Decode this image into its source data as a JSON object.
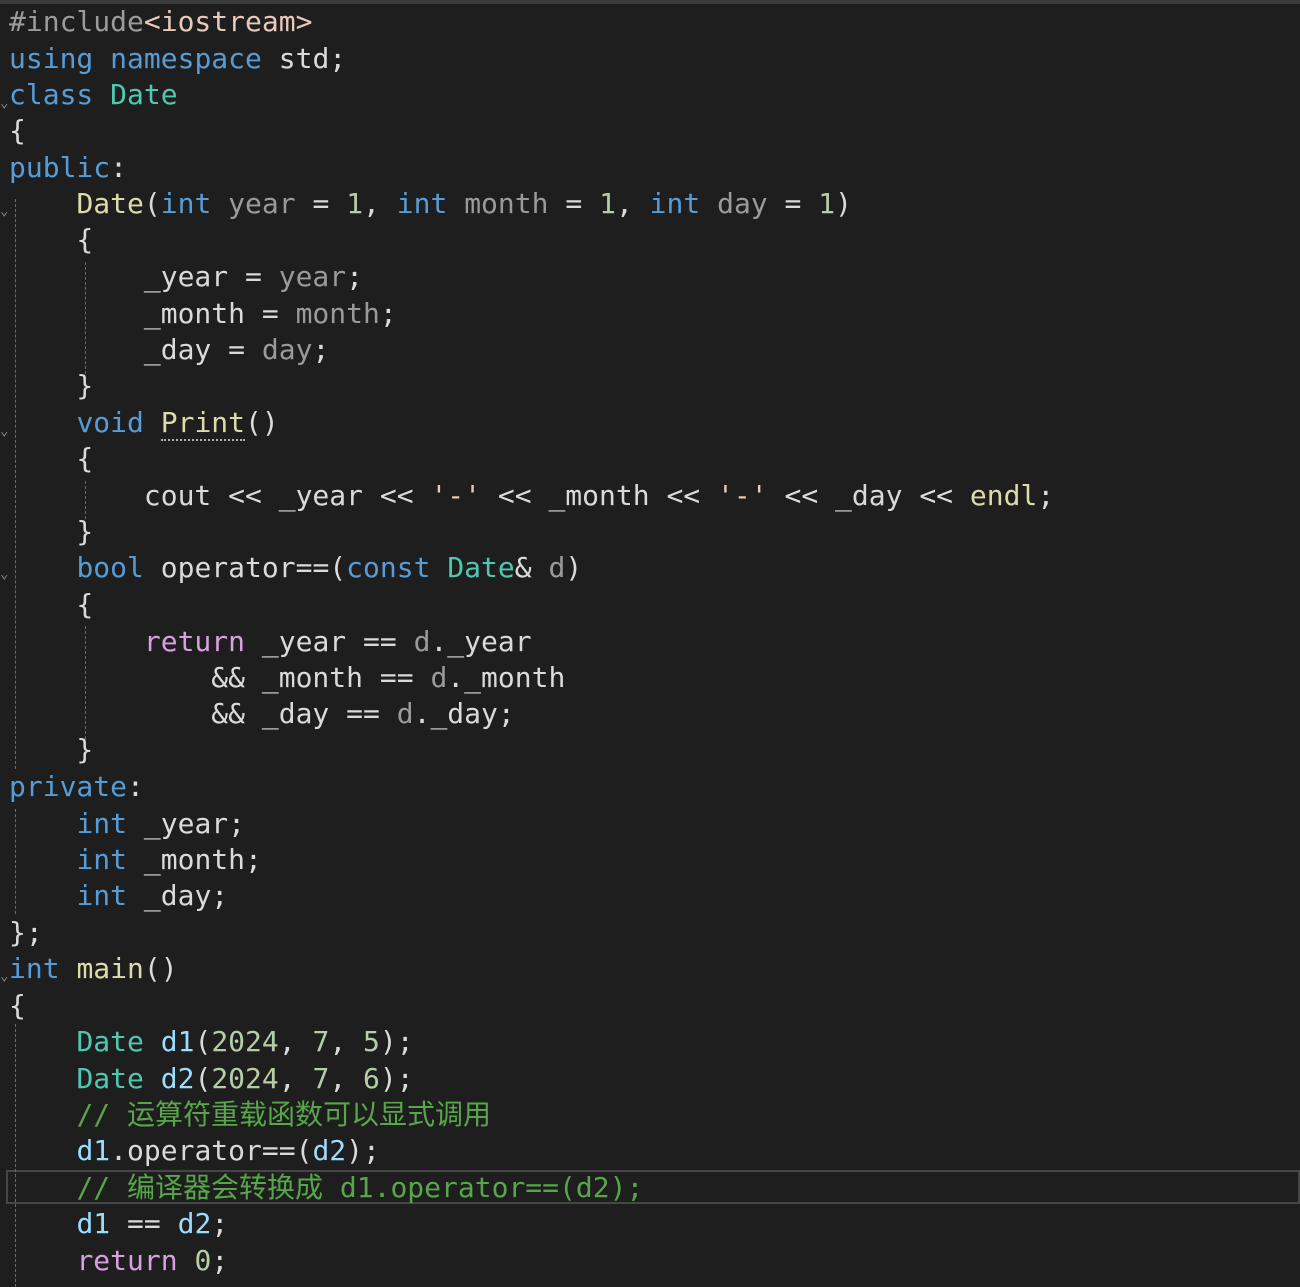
{
  "editor": {
    "background": "#1e1e1e",
    "lines": [
      [
        [
          "pp",
          "#include"
        ],
        [
          "inc",
          "<iostream>"
        ]
      ],
      [
        [
          "kw",
          "using"
        ],
        [
          "plain",
          " "
        ],
        [
          "kw",
          "namespace"
        ],
        [
          "plain",
          " std;"
        ]
      ],
      [
        [
          "kw",
          "class"
        ],
        [
          "plain",
          " "
        ],
        [
          "typ",
          "Date"
        ]
      ],
      [
        [
          "plain",
          "{"
        ]
      ],
      [
        [
          "kw",
          "public"
        ],
        [
          "plain",
          ":"
        ]
      ],
      [
        [
          "plain",
          "    "
        ],
        [
          "fn",
          "Date"
        ],
        [
          "plain",
          "("
        ],
        [
          "kw",
          "int"
        ],
        [
          "plain",
          " "
        ],
        [
          "prm",
          "year"
        ],
        [
          "plain",
          " = "
        ],
        [
          "num",
          "1"
        ],
        [
          "plain",
          ", "
        ],
        [
          "kw",
          "int"
        ],
        [
          "plain",
          " "
        ],
        [
          "prm",
          "month"
        ],
        [
          "plain",
          " = "
        ],
        [
          "num",
          "1"
        ],
        [
          "plain",
          ", "
        ],
        [
          "kw",
          "int"
        ],
        [
          "plain",
          " "
        ],
        [
          "prm",
          "day"
        ],
        [
          "plain",
          " = "
        ],
        [
          "num",
          "1"
        ],
        [
          "plain",
          ")"
        ]
      ],
      [
        [
          "plain",
          "    {"
        ]
      ],
      [
        [
          "plain",
          "        _year = "
        ],
        [
          "prm",
          "year"
        ],
        [
          "plain",
          ";"
        ]
      ],
      [
        [
          "plain",
          "        _month = "
        ],
        [
          "prm",
          "month"
        ],
        [
          "plain",
          ";"
        ]
      ],
      [
        [
          "plain",
          "        _day = "
        ],
        [
          "prm",
          "day"
        ],
        [
          "plain",
          ";"
        ]
      ],
      [
        [
          "plain",
          "    }"
        ]
      ],
      [
        [
          "plain",
          "    "
        ],
        [
          "kw",
          "void"
        ],
        [
          "plain",
          " "
        ],
        [
          "fnu",
          "Print"
        ],
        [
          "plain",
          "()"
        ]
      ],
      [
        [
          "plain",
          "    {"
        ]
      ],
      [
        [
          "plain",
          "        cout << _year << "
        ],
        [
          "str",
          "'-'"
        ],
        [
          "plain",
          " << _month << "
        ],
        [
          "str",
          "'-'"
        ],
        [
          "plain",
          " << _day << "
        ],
        [
          "fn",
          "endl"
        ],
        [
          "plain",
          ";"
        ]
      ],
      [
        [
          "plain",
          "    }"
        ]
      ],
      [
        [
          "plain",
          "    "
        ],
        [
          "kw",
          "bool"
        ],
        [
          "plain",
          " operator==("
        ],
        [
          "kw",
          "const"
        ],
        [
          "plain",
          " "
        ],
        [
          "typ",
          "Date"
        ],
        [
          "plain",
          "& "
        ],
        [
          "prm",
          "d"
        ],
        [
          "plain",
          ")"
        ]
      ],
      [
        [
          "plain",
          "    {"
        ]
      ],
      [
        [
          "plain",
          "        "
        ],
        [
          "ctl",
          "return"
        ],
        [
          "plain",
          " _year == "
        ],
        [
          "prm",
          "d"
        ],
        [
          "plain",
          "._year"
        ]
      ],
      [
        [
          "plain",
          "            && _month == "
        ],
        [
          "prm",
          "d"
        ],
        [
          "plain",
          "._month"
        ]
      ],
      [
        [
          "plain",
          "            && _day == "
        ],
        [
          "prm",
          "d"
        ],
        [
          "plain",
          "._day;"
        ]
      ],
      [
        [
          "plain",
          "    }"
        ]
      ],
      [
        [
          "kw",
          "private"
        ],
        [
          "plain",
          ":"
        ]
      ],
      [
        [
          "plain",
          "    "
        ],
        [
          "kw",
          "int"
        ],
        [
          "plain",
          " _year;"
        ]
      ],
      [
        [
          "plain",
          "    "
        ],
        [
          "kw",
          "int"
        ],
        [
          "plain",
          " _month;"
        ]
      ],
      [
        [
          "plain",
          "    "
        ],
        [
          "kw",
          "int"
        ],
        [
          "plain",
          " _day;"
        ]
      ],
      [
        [
          "plain",
          "};"
        ]
      ],
      [
        [
          "kw",
          "int"
        ],
        [
          "plain",
          " "
        ],
        [
          "fn",
          "main"
        ],
        [
          "plain",
          "()"
        ]
      ],
      [
        [
          "plain",
          "{"
        ]
      ],
      [
        [
          "plain",
          "    "
        ],
        [
          "typ",
          "Date"
        ],
        [
          "plain",
          " "
        ],
        [
          "var",
          "d1"
        ],
        [
          "plain",
          "("
        ],
        [
          "num",
          "2024"
        ],
        [
          "plain",
          ", "
        ],
        [
          "num",
          "7"
        ],
        [
          "plain",
          ", "
        ],
        [
          "num",
          "5"
        ],
        [
          "plain",
          ");"
        ]
      ],
      [
        [
          "plain",
          "    "
        ],
        [
          "typ",
          "Date"
        ],
        [
          "plain",
          " "
        ],
        [
          "var",
          "d2"
        ],
        [
          "plain",
          "("
        ],
        [
          "num",
          "2024"
        ],
        [
          "plain",
          ", "
        ],
        [
          "num",
          "7"
        ],
        [
          "plain",
          ", "
        ],
        [
          "num",
          "6"
        ],
        [
          "plain",
          ");"
        ]
      ],
      [
        [
          "plain",
          "    "
        ],
        [
          "cmt",
          "// 运算符重载函数可以显式调用"
        ]
      ],
      [
        [
          "plain",
          "    "
        ],
        [
          "var",
          "d1"
        ],
        [
          "plain",
          ".operator==("
        ],
        [
          "var",
          "d2"
        ],
        [
          "plain",
          ");"
        ]
      ],
      [
        [
          "plain",
          "    "
        ],
        [
          "cmt",
          "// 编译器会转换成 d1.operator==(d2);"
        ]
      ],
      [
        [
          "plain",
          "    "
        ],
        [
          "var",
          "d1"
        ],
        [
          "plain",
          " == "
        ],
        [
          "var",
          "d2"
        ],
        [
          "plain",
          ";"
        ]
      ],
      [
        [
          "plain",
          "    "
        ],
        [
          "ctl",
          "return"
        ],
        [
          "plain",
          " "
        ],
        [
          "num",
          "0"
        ],
        [
          "plain",
          ";"
        ]
      ]
    ]
  }
}
